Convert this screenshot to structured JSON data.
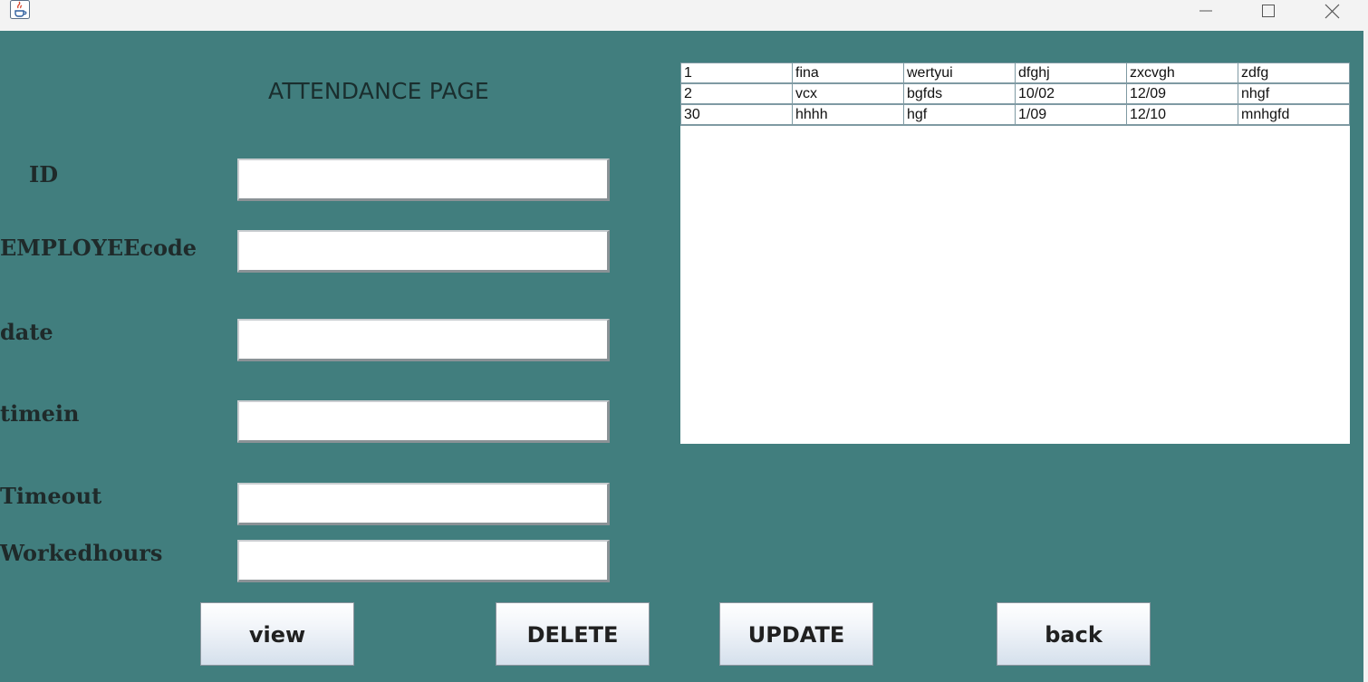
{
  "window": {
    "app_icon": "java-cup-icon",
    "controls": [
      "minimize-icon",
      "maximize-icon",
      "close-icon"
    ]
  },
  "form": {
    "heading": "ATTENDANCE PAGE",
    "fields": [
      {
        "label": "ID",
        "value": ""
      },
      {
        "label": "EMPLOYEEcode",
        "value": ""
      },
      {
        "label": "date",
        "value": ""
      },
      {
        "label": "timein",
        "value": ""
      },
      {
        "label": "Timeout",
        "value": ""
      },
      {
        "label": "Workedhours",
        "value": ""
      }
    ]
  },
  "table": {
    "rows": [
      [
        "1",
        "fina",
        "wertyui",
        "dfghj",
        "zxcvgh",
        "zdfg"
      ],
      [
        "2",
        "vcx",
        "bgfds",
        "10/02",
        "12/09",
        "nhgf"
      ],
      [
        "30",
        "hhhh",
        "hgf",
        "1/09",
        "12/10",
        "mnhgfd"
      ]
    ]
  },
  "buttons": {
    "view": "view",
    "delete": "DELETE",
    "update": "UPDATE",
    "back": "back"
  },
  "colors": {
    "background": "#417e7e",
    "titlebar": "#f3f3f3"
  }
}
